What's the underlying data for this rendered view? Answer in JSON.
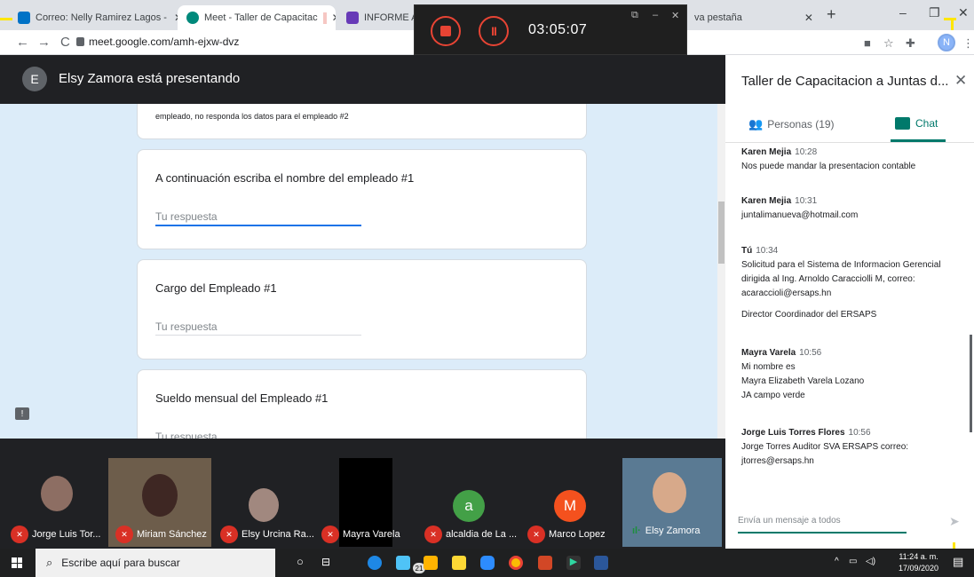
{
  "browser": {
    "tabs": [
      {
        "title": "Correo: Nelly Ramirez Lagos - ",
        "icon_color": "#0072c6"
      },
      {
        "title": "Meet - Taller de Capacitac",
        "icon_color": "#00897b"
      },
      {
        "title": "INFORME AN",
        "icon_color": "#673ab7"
      },
      {
        "title": "va pestaña",
        "icon_color": "#dee1e6"
      }
    ],
    "url": "meet.google.com/amh-ejxw-dvz",
    "profile_initial": "N"
  },
  "recorder": {
    "timer": "03:05:07"
  },
  "presenter": {
    "initial": "E",
    "text": "Elsy Zamora está presentando"
  },
  "form": {
    "top_fragment": "empleado, no responda los datos para el empleado #2",
    "questions": [
      {
        "label": "A continuación escriba el nombre del empleado #1",
        "placeholder": "Tu respuesta"
      },
      {
        "label": "Cargo del Empleado #1",
        "placeholder": "Tu respuesta"
      },
      {
        "label": "Sueldo mensual del Empleado #1",
        "placeholder": "Tu respuesta"
      }
    ]
  },
  "participants": [
    {
      "name": "Jorge Luis Tor...",
      "muted": true
    },
    {
      "name": "Miriam Sánchez",
      "muted": true
    },
    {
      "name": "Elsy Urcina Ra...",
      "muted": true
    },
    {
      "name": "Mayra Varela",
      "muted": true
    },
    {
      "name": "alcaldia de La ...",
      "muted": true,
      "initial": "a",
      "color": "#43a047"
    },
    {
      "name": "Marco Lopez",
      "muted": true,
      "initial": "M",
      "color": "#f4511e"
    },
    {
      "name": "Elsy Zamora",
      "muted": false
    }
  ],
  "panel": {
    "title": "Taller de Capacitacion a Juntas d...",
    "people_tab": "Personas (19)",
    "chat_tab": "Chat",
    "input_placeholder": "Envía un mensaje a todos",
    "messages": [
      {
        "author": "Karen Mejia",
        "time": "10:28",
        "lines": [
          "Nos puede mandar la presentacion contable"
        ]
      },
      {
        "author": "Karen Mejia",
        "time": "10:31",
        "lines": [
          "juntalimanueva@hotmail.com"
        ]
      },
      {
        "author": "Tú",
        "time": "10:34",
        "lines": [
          "Solicitud para el Sistema de Informacion Gerencial",
          "dirigida al Ing. Arnoldo Caracciolli M, correo:",
          "acaraccioli@ersaps.hn",
          "",
          "Director Coordinador del ERSAPS"
        ]
      },
      {
        "author": "Mayra Varela",
        "time": "10:56",
        "lines": [
          "Mi nombre es",
          "Mayra Elizabeth Varela Lozano",
          "JA campo verde"
        ]
      },
      {
        "author": "Jorge Luis Torres Flores",
        "time": "10:56",
        "lines": [
          "Jorge Torres  Auditor SVA ERSAPS  correo:",
          "jtorres@ersaps.hn"
        ]
      }
    ]
  },
  "taskbar": {
    "search_placeholder": "Escribe aquí para buscar",
    "badge": "21",
    "time": "11:24 a. m.",
    "date": "17/09/2020"
  }
}
